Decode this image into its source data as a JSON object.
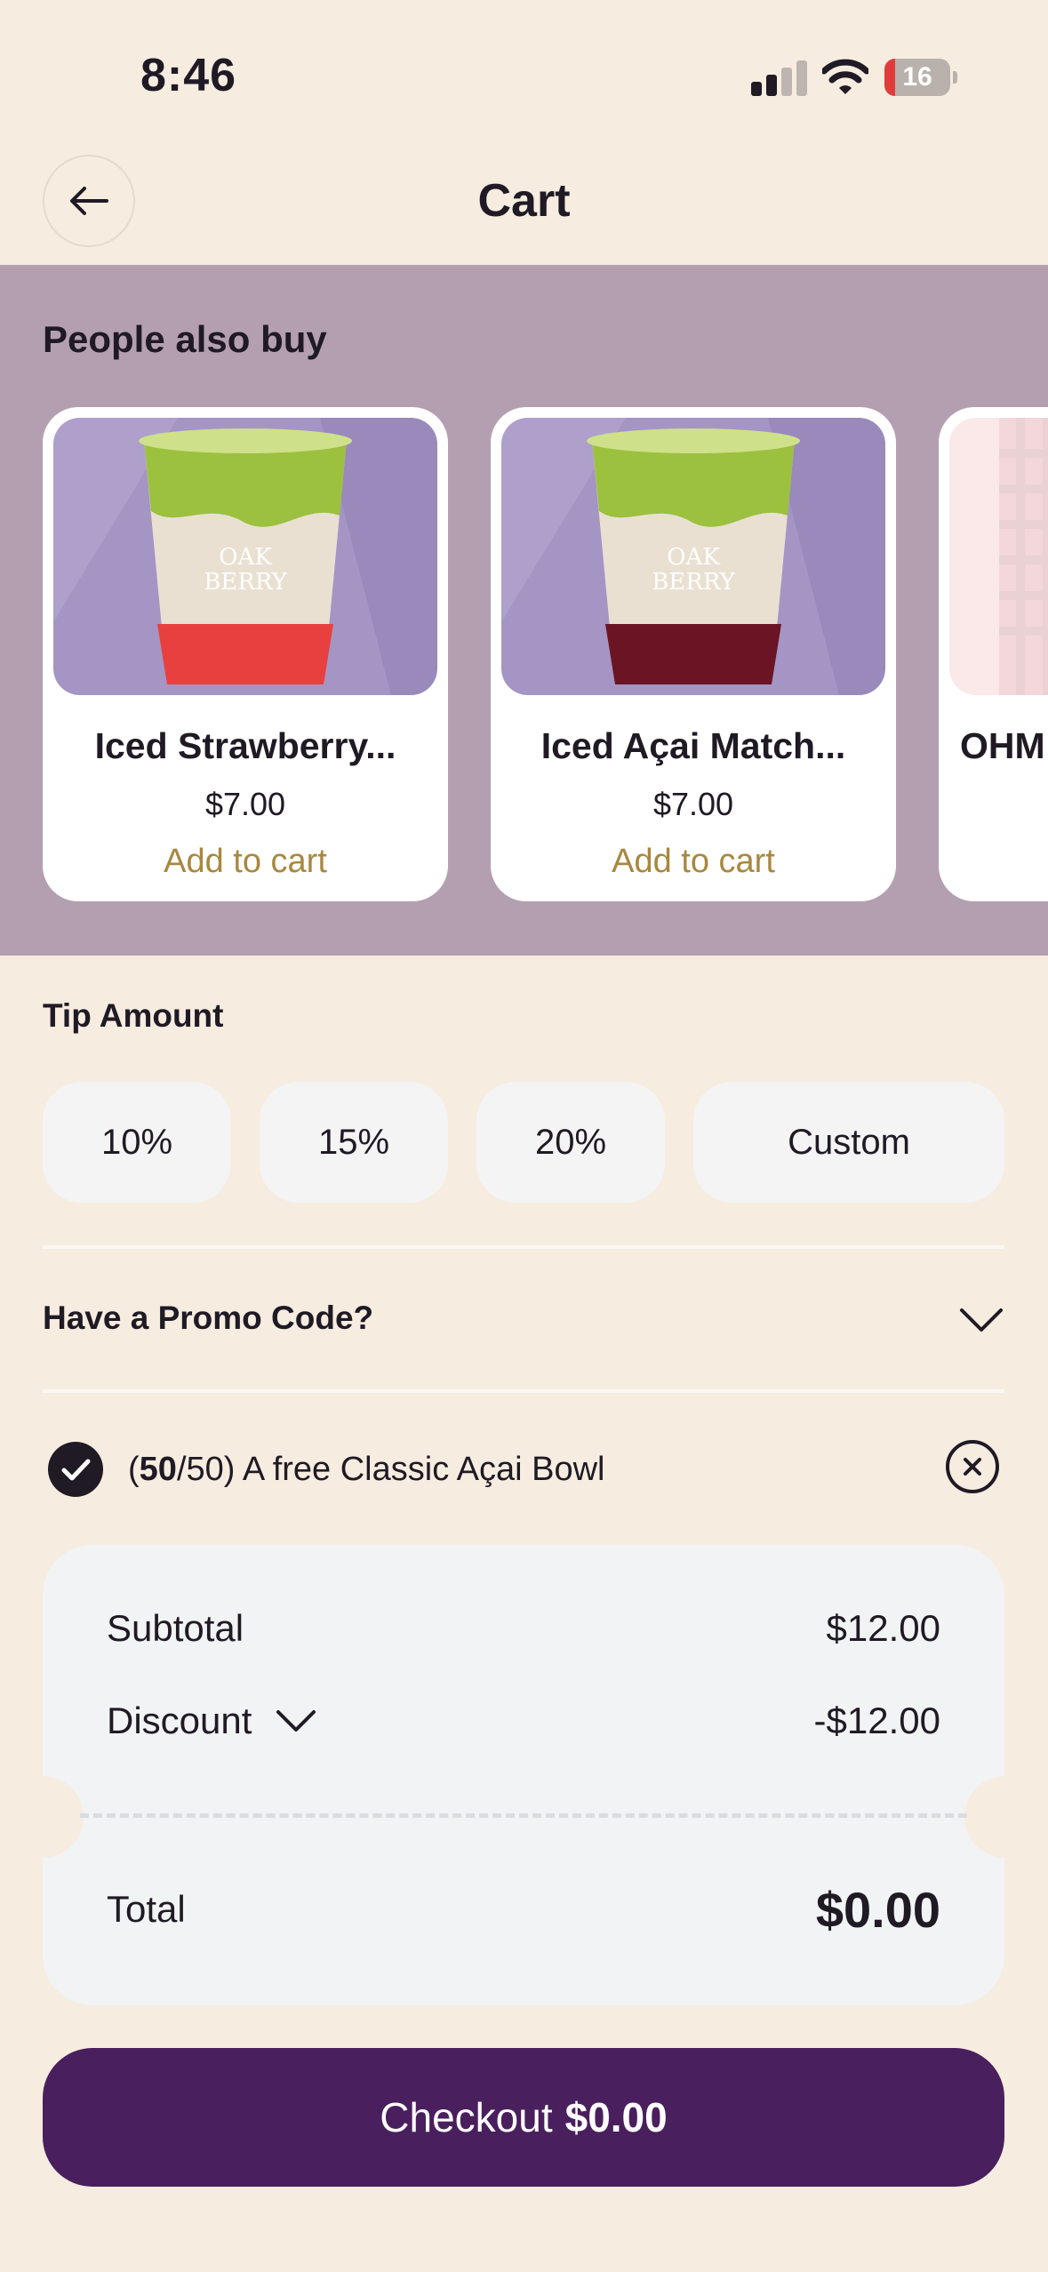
{
  "status_bar": {
    "time": "8:46",
    "battery": "16",
    "battery_level": 0.16
  },
  "header": {
    "title": "Cart"
  },
  "upsell": {
    "title": "People also buy",
    "products": [
      {
        "name": "Iced Strawberry...",
        "price": "$7.00",
        "action": "Add to cart",
        "bottom_color": "#e8403f"
      },
      {
        "name": "Iced Açai Match...",
        "price": "$7.00",
        "action": "Add to cart",
        "bottom_color": "#6a1424"
      },
      {
        "name": "OHM",
        "price": "",
        "action": ""
      }
    ],
    "logo_text": [
      "OAK",
      "BERRY"
    ]
  },
  "tip": {
    "label": "Tip Amount",
    "options": [
      "10%",
      "15%",
      "20%",
      "Custom"
    ]
  },
  "promo": {
    "label": "Have a Promo Code?"
  },
  "applied_reward": {
    "open_paren": "(",
    "count_bold": "50",
    "count_rest": "/50)",
    "description": "A free Classic Açai Bowl"
  },
  "summary": {
    "subtotal_label": "Subtotal",
    "subtotal_value": "$12.00",
    "discount_label": "Discount",
    "discount_value": "-$12.00",
    "total_label": "Total",
    "total_value": "$0.00"
  },
  "checkout": {
    "label": "Checkout",
    "amount": "$0.00"
  },
  "colors": {
    "background": "#f6ece0",
    "upsell_band": "#b49fb1",
    "accent_gold": "#a8873f",
    "checkout_purple": "#4a1f5d"
  }
}
